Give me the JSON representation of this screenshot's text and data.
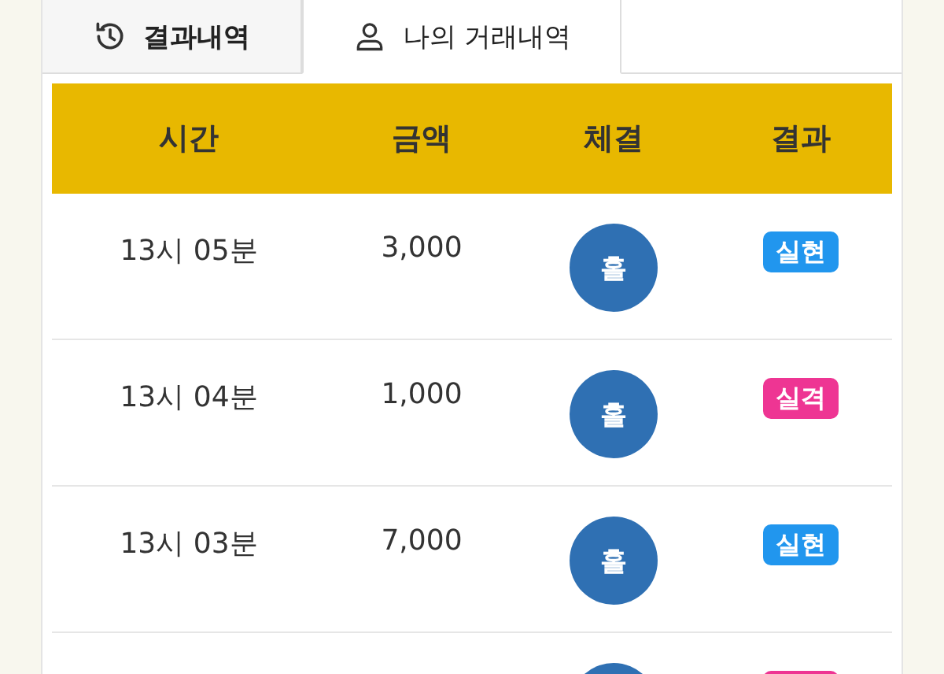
{
  "tabs": [
    {
      "label": "결과내역",
      "kind": "history",
      "selected": false
    },
    {
      "label": "나의 거래내역",
      "kind": "person",
      "selected": true
    }
  ],
  "table": {
    "columns": [
      "시간",
      "금액",
      "체결",
      "결과"
    ],
    "rows": [
      {
        "time": "13시 05분",
        "amount": "3,000",
        "fill": "홀",
        "result": "실현",
        "color": "#2196ee"
      },
      {
        "time": "13시 04분",
        "amount": "1,000",
        "fill": "홀",
        "result": "실격",
        "color": "#ee3593"
      },
      {
        "time": "13시 03분",
        "amount": "7,000",
        "fill": "홀",
        "result": "실현",
        "color": "#2196ee"
      },
      {
        "color": "#ee3593"
      }
    ]
  }
}
